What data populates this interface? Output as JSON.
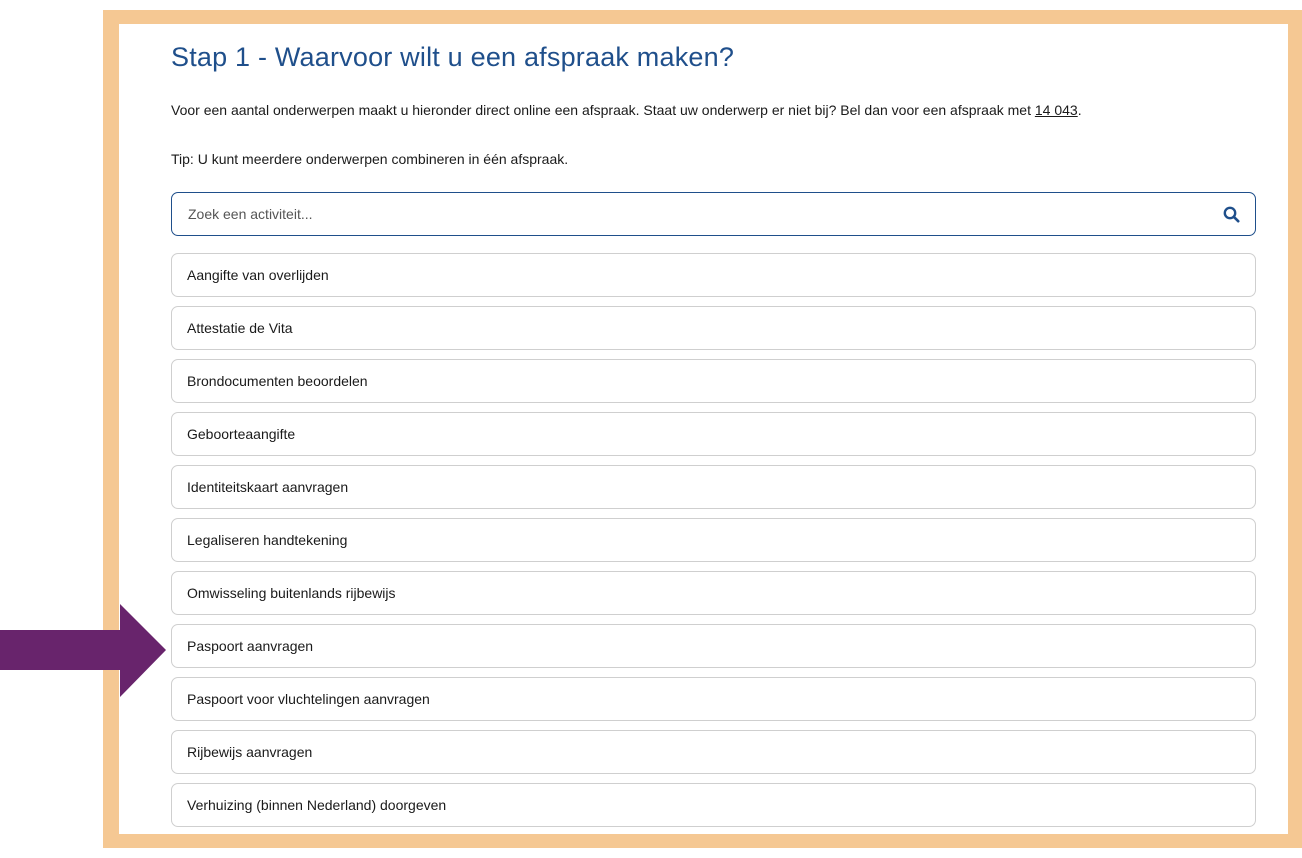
{
  "header": {
    "title": "Stap 1 - Waarvoor wilt u een afspraak maken?"
  },
  "intro": {
    "text": "Voor een aantal onderwerpen maakt u hieronder direct online een afspraak. Staat uw onderwerp er niet bij? Bel dan voor een afspraak met ",
    "phone_link": "14 043",
    "after": "."
  },
  "tip": "Tip: U kunt meerdere onderwerpen combineren in één afspraak.",
  "search": {
    "placeholder": "Zoek een activiteit...",
    "icon": "search-icon"
  },
  "activities": [
    "Aangifte van overlijden",
    "Attestatie de Vita",
    "Brondocumenten beoordelen",
    "Geboorteaangifte",
    "Identiteitskaart aanvragen",
    "Legaliseren handtekening",
    "Omwisseling buitenlands rijbewijs",
    "Paspoort aanvragen",
    "Paspoort voor vluchtelingen aanvragen",
    "Rijbewijs aanvragen",
    "Verhuizing (binnen Nederland) doorgeven"
  ],
  "annotation": {
    "icon": "arrow-right-icon",
    "color": "#68246c",
    "points_to": "Paspoort aanvragen"
  },
  "colors": {
    "frame": "#f5c893",
    "title": "#1f4f8b",
    "search_border": "#1f4f8b",
    "item_border": "#cfcfcf"
  }
}
